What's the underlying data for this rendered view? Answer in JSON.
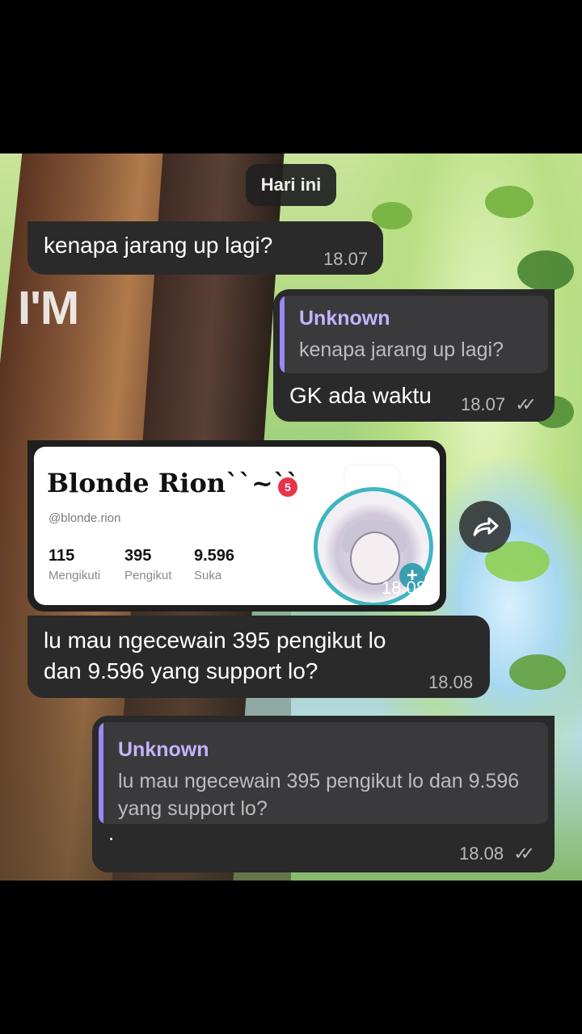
{
  "background": {
    "watermark": "I'M"
  },
  "date_separator": "Hari ini",
  "messages": [
    {
      "text": "kenapa jarang up lagi?",
      "time": "18.07"
    },
    {
      "reply_name": "Unknown",
      "reply_text": "kenapa jarang up lagi?",
      "text": "GK ada waktu",
      "time": "18.07",
      "status": "read"
    },
    {
      "profile": {
        "name": "Blonde Rion``~``",
        "badge": "5",
        "handle": "@blonde.rion",
        "stats": [
          {
            "value": "115",
            "label": "Mengikuti"
          },
          {
            "value": "395",
            "label": "Pengikut"
          },
          {
            "value": "9.596",
            "label": "Suka"
          }
        ]
      },
      "time": "18.08"
    },
    {
      "text": "lu mau ngecewain 395 pengikut lo\ndan 9.596 yang support lo?",
      "time": "18.08"
    },
    {
      "reply_name": "Unknown",
      "reply_text": "lu mau ngecewain 395 pengikut lo dan 9.596 yang support lo?",
      "text": ".",
      "time": "18.08",
      "status": "read"
    }
  ],
  "icons": {
    "forward": "share-forward-icon",
    "read_receipt": "double-check-icon"
  },
  "colors": {
    "bubble": "#2a2a2a",
    "accent": "#9b87f5",
    "quote_name": "#c4b3ff"
  }
}
